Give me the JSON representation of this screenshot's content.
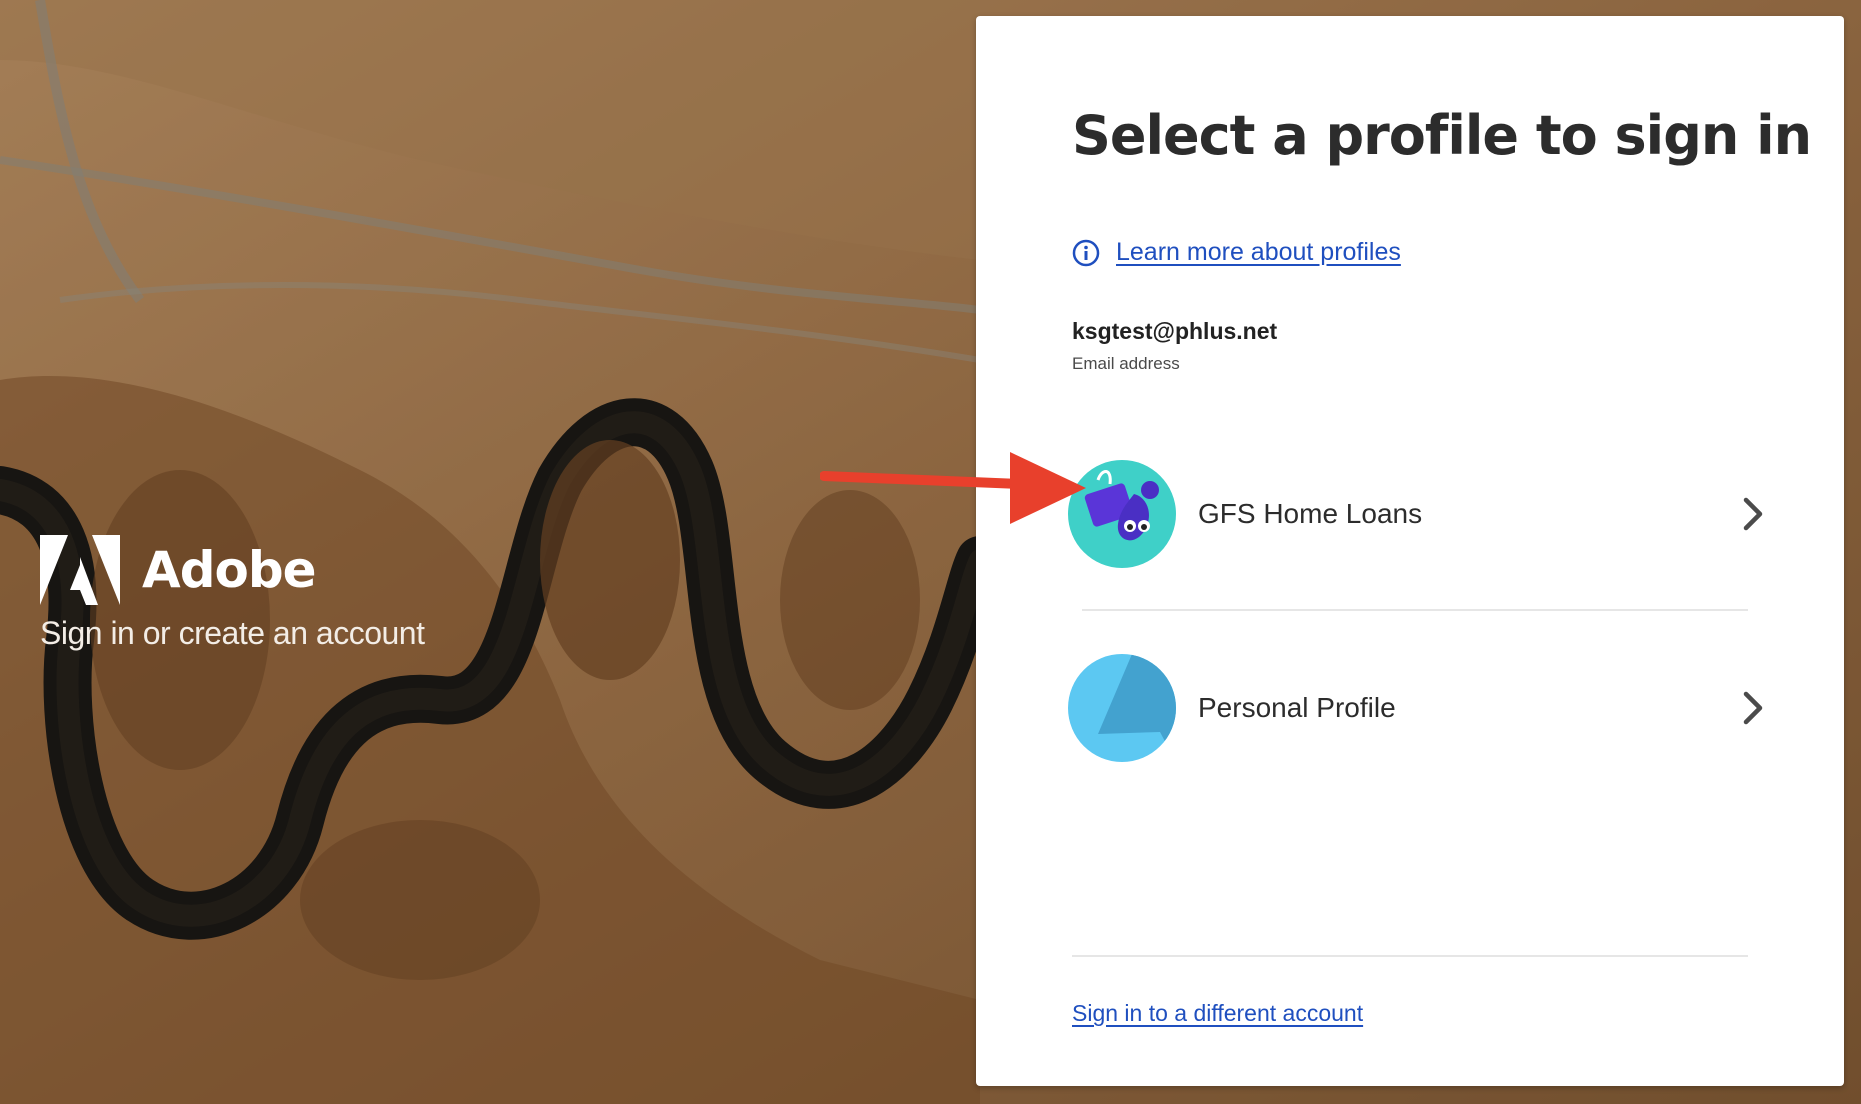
{
  "brand": {
    "name": "Adobe",
    "tagline": "Sign in or create an account"
  },
  "card": {
    "title": "Select a profile to sign in",
    "learn_link": "Learn more about profiles",
    "email": "ksgtest@phlus.net",
    "email_label": "Email address",
    "profiles": [
      {
        "name": "GFS Home Loans",
        "icon": "illustrated-avatar-icon"
      },
      {
        "name": "Personal Profile",
        "icon": "blue-triangle-avatar-icon"
      }
    ],
    "switch_account": "Sign in to a different account"
  },
  "colors": {
    "link": "#1f4fbf",
    "annotation_arrow": "#e8402c",
    "card_bg": "#ffffff"
  }
}
